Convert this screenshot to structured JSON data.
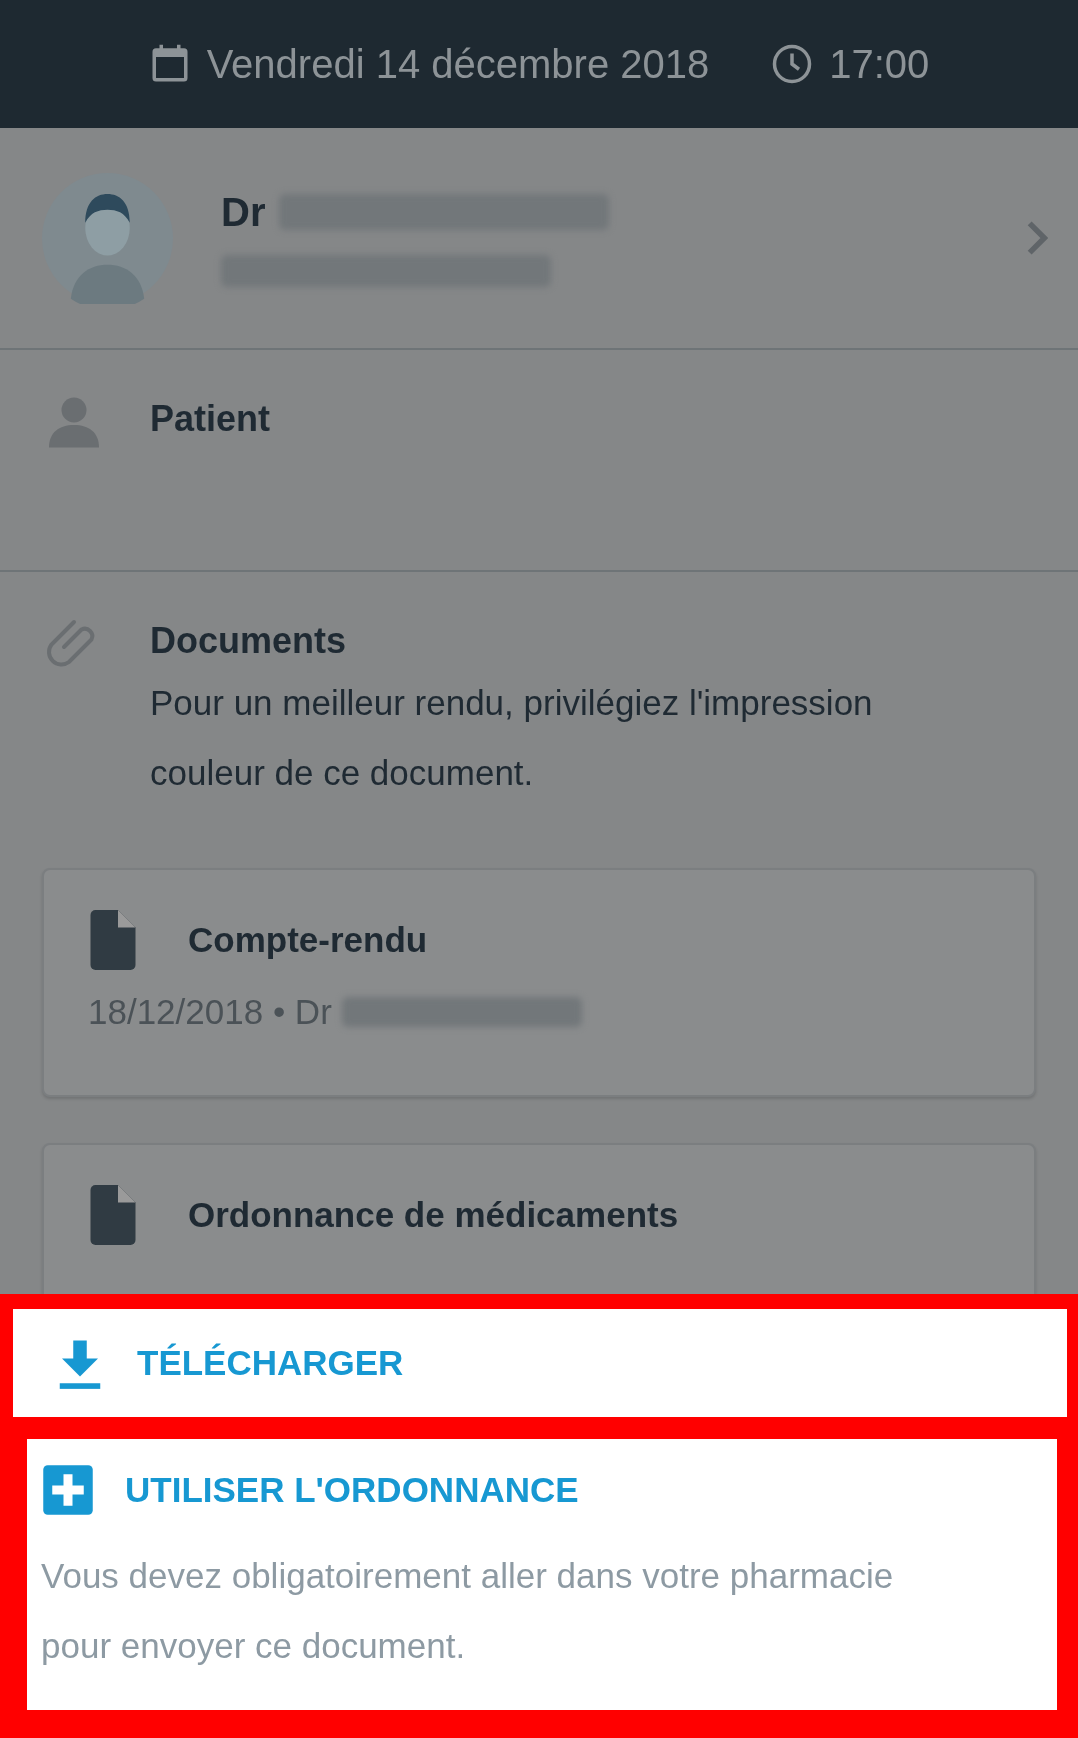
{
  "header": {
    "date": "Vendredi 14 décembre 2018",
    "time": "17:00"
  },
  "doctor": {
    "title": "Dr"
  },
  "sections": [
    {
      "kind": "patient",
      "title": "Patient"
    },
    {
      "kind": "documents",
      "title": "Documents",
      "note": "Pour un meilleur rendu, privilégiez l'impression couleur de ce document."
    }
  ],
  "documents": [
    {
      "title": "Compte-rendu",
      "meta": "18/12/2018 • Dr"
    },
    {
      "title": "Ordonnance de médicaments"
    }
  ],
  "sheet": {
    "actions": [
      {
        "kind": "download",
        "label": "TÉLÉCHARGER"
      },
      {
        "kind": "prescription",
        "label": "UTILISER L'ORDONNANCE",
        "note": "Vous devez obligatoirement aller dans votre pharmacie pour envoyer ce document."
      }
    ]
  }
}
